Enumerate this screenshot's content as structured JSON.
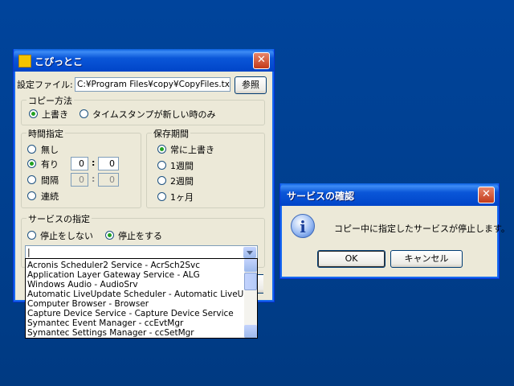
{
  "main_window": {
    "title": "こぴっとこ",
    "close": "✕",
    "settings_file_label": "設定ファイル:",
    "settings_file_value": "C:¥Program Files¥copy¥CopyFiles.txt",
    "browse_button": "参照",
    "copy_method": {
      "title": "コピー方法",
      "options": [
        "上書き",
        "タイムスタンプが新しい時のみ"
      ],
      "selected": 0
    },
    "time_spec": {
      "title": "時間指定",
      "options": [
        "無し",
        "有り",
        "間隔",
        "連続"
      ],
      "selected": 1,
      "time_on": {
        "hour": "0",
        "minute": "0"
      },
      "interval": {
        "hour": "0",
        "minute": "0"
      },
      "separator": ":"
    },
    "retention": {
      "title": "保存期間",
      "options": [
        "常に上書き",
        "1週間",
        "2週間",
        "1ヶ月"
      ],
      "selected": 0
    },
    "service": {
      "title": "サービスの指定",
      "options": [
        "停止をしない",
        "停止をする"
      ],
      "selected": 1,
      "combo_value": "|"
    },
    "service_list": [
      "Acronis Scheduler2 Service - AcrSch2Svc",
      "Application Layer Gateway Service - ALG",
      "Windows Audio - AudioSrv",
      "Automatic LiveUpdate Scheduler - Automatic LiveUp",
      "Computer Browser - Browser",
      "Capture Device Service - Capture Device Service",
      "Symantec Event Manager - ccEvtMgr",
      "Symantec Settings Manager - ccSetMgr"
    ]
  },
  "dialog": {
    "title": "サービスの確認",
    "close": "✕",
    "icon": "i",
    "message": "コピー中に指定したサービスが停止します。",
    "ok_button": "OK",
    "cancel_button": "キャンセル"
  },
  "colors": {
    "desktop": "#003c74",
    "titlebar": "#0a56d8",
    "window_face": "#ece9d8"
  }
}
